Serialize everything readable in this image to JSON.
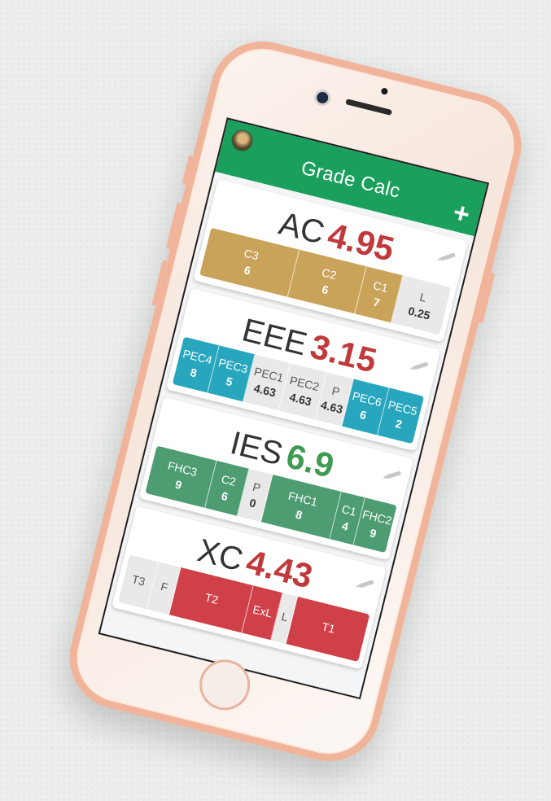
{
  "app": {
    "title": "Grade Calc",
    "add_label": "+",
    "color": "#1aa05c"
  },
  "colors": {
    "gold": "#c9a35a",
    "teal": "#27a6bd",
    "green": "#4e9c72",
    "red": "#d04048",
    "grey": "#e9e9e9",
    "score_red": "#c0393b",
    "score_green": "#3f9a52"
  },
  "cards": [
    {
      "name": "AC",
      "score": "4.95",
      "score_color": "#c0393b",
      "segments": [
        {
          "label": "C3",
          "value": "6",
          "color": "#c9a35a",
          "flex": 4
        },
        {
          "label": "C2",
          "value": "6",
          "color": "#c9a35a",
          "flex": 3
        },
        {
          "label": "C1",
          "value": "7",
          "color": "#c9a35a",
          "flex": 1.6
        },
        {
          "label": "L",
          "value": "0.25",
          "color": "grey",
          "flex": 2.2
        }
      ]
    },
    {
      "name": "EEE",
      "score": "3.15",
      "score_color": "#c0393b",
      "segments": [
        {
          "label": "PEC4",
          "value": "8",
          "color": "#27a6bd",
          "flex": 1.6
        },
        {
          "label": "PEC3",
          "value": "5",
          "color": "#27a6bd",
          "flex": 1.6
        },
        {
          "label": "PEC1",
          "value": "4.63",
          "color": "grey",
          "flex": 1.6
        },
        {
          "label": "PEC2",
          "value": "4.63",
          "color": "grey",
          "flex": 1.6
        },
        {
          "label": "P",
          "value": "4.63",
          "color": "grey",
          "flex": 1.2
        },
        {
          "label": "PEC6",
          "value": "6",
          "color": "#27a6bd",
          "flex": 1.6
        },
        {
          "label": "PEC5",
          "value": "2",
          "color": "#27a6bd",
          "flex": 1.6
        }
      ]
    },
    {
      "name": "IES",
      "score": "6.9",
      "score_color": "#3f9a52",
      "segments": [
        {
          "label": "FHC3",
          "value": "9",
          "color": "#4e9c72",
          "flex": 2.6
        },
        {
          "label": "C2",
          "value": "6",
          "color": "#4e9c72",
          "flex": 1.4
        },
        {
          "label": "P",
          "value": "0",
          "color": "grey",
          "flex": 1
        },
        {
          "label": "FHC1",
          "value": "8",
          "color": "#4e9c72",
          "flex": 3
        },
        {
          "label": "C1",
          "value": "4",
          "color": "#4e9c72",
          "flex": 1
        },
        {
          "label": "FHC2",
          "value": "9",
          "color": "#4e9c72",
          "flex": 1.4
        }
      ]
    },
    {
      "name": "XC",
      "score": "4.43",
      "score_color": "#c0393b",
      "segments": [
        {
          "label": "T3",
          "value": "",
          "color": "grey",
          "flex": 1.2
        },
        {
          "label": "F",
          "value": "",
          "color": "grey",
          "flex": 0.9
        },
        {
          "label": "T2",
          "value": "",
          "color": "#d04048",
          "flex": 3
        },
        {
          "label": "ExL",
          "value": "",
          "color": "#d04048",
          "flex": 1.2
        },
        {
          "label": "L",
          "value": "",
          "color": "grey",
          "flex": 0.6
        },
        {
          "label": "T1",
          "value": "",
          "color": "#d04048",
          "flex": 3
        }
      ]
    }
  ]
}
